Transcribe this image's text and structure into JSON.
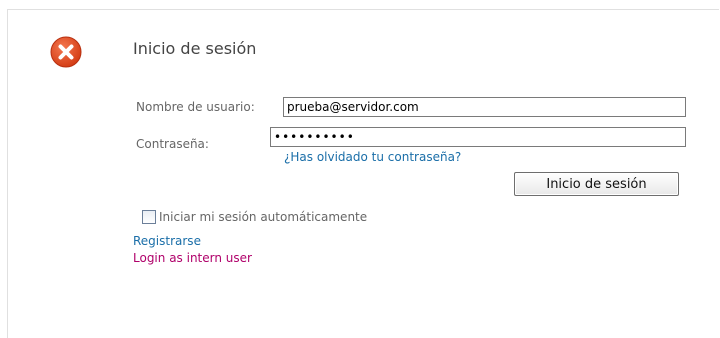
{
  "login": {
    "title": "Inicio de sesión",
    "username_label": "Nombre de usuario:",
    "username_value": "prueba@servidor.com",
    "password_label": "Contraseña:",
    "password_value": "••••••••••",
    "forgot_link": "¿Has olvidado tu contraseña?",
    "submit_label": "Inicio de sesión",
    "remember_label": "Iniciar mi sesión automáticamente",
    "register_link": "Registrarse",
    "intern_link": "Login as intern user"
  },
  "icons": {
    "status": "error-x-icon"
  },
  "colors": {
    "error_icon": "#e2491f",
    "link": "#1a6ea8",
    "intern_link": "#b0006a"
  }
}
